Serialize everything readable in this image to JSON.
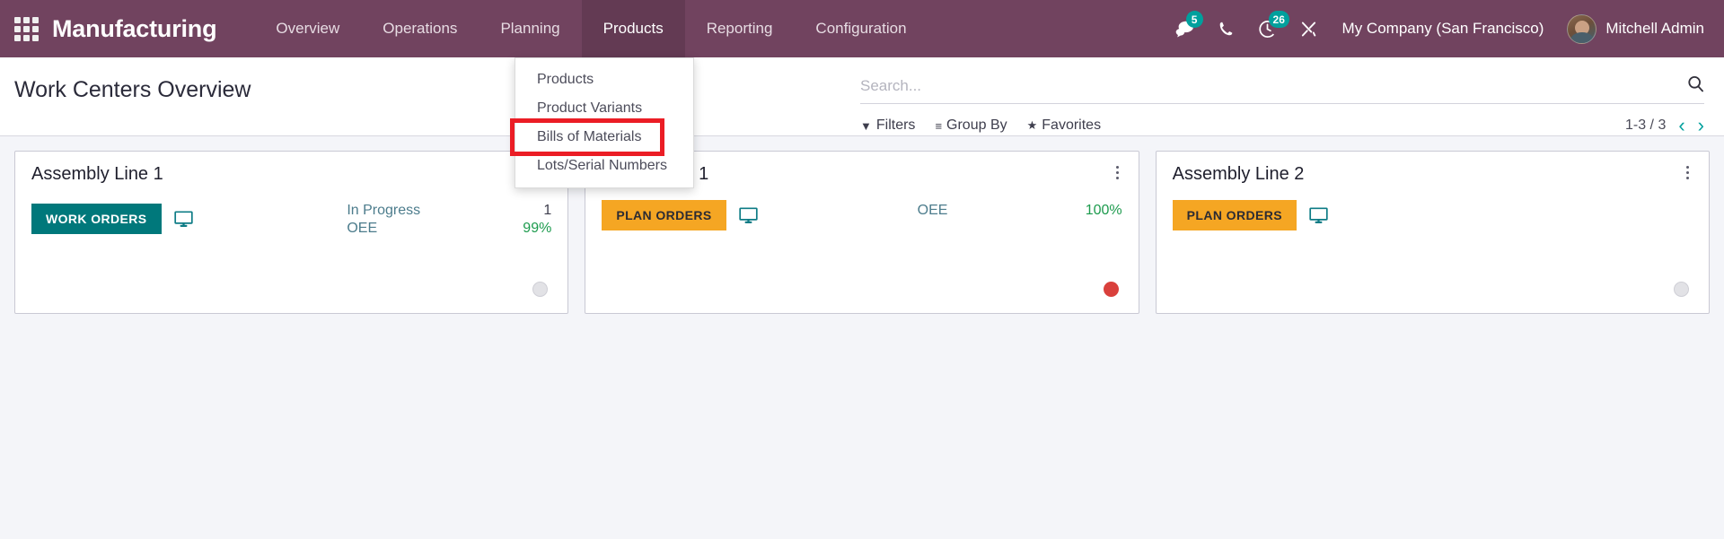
{
  "colors": {
    "navbar": "#71435F",
    "accent_teal": "#00A09D",
    "btn_work_orders": "#00787B",
    "btn_plan_orders": "#F5A623",
    "status_green": "#1D9B4E",
    "status_red": "#D9403C",
    "status_gray": "#E2E2E6",
    "highlight_box": "#EB1D25",
    "page_background": "#F4F5F9"
  },
  "navbar": {
    "apps_icon": "apps-grid-icon",
    "brand": "Manufacturing",
    "menu": [
      {
        "label": "Overview",
        "active": false
      },
      {
        "label": "Operations",
        "active": false
      },
      {
        "label": "Planning",
        "active": false
      },
      {
        "label": "Products",
        "active": true
      },
      {
        "label": "Reporting",
        "active": false
      },
      {
        "label": "Configuration",
        "active": false
      }
    ],
    "systray": [
      {
        "icon": "messages-icon",
        "badge": "5"
      },
      {
        "icon": "phone-icon",
        "badge": ""
      },
      {
        "icon": "activities-icon",
        "badge": "26"
      },
      {
        "icon": "tools-icon",
        "badge": ""
      }
    ],
    "company": "My Company (San Francisco)",
    "user": "Mitchell Admin"
  },
  "dropdown": {
    "open_for": "Products",
    "items": [
      {
        "label": "Products",
        "highlighted": false
      },
      {
        "label": "Product Variants",
        "highlighted": false
      },
      {
        "label": "Bills of Materials",
        "highlighted": true
      },
      {
        "label": "Lots/Serial Numbers",
        "highlighted": false
      }
    ]
  },
  "control_panel": {
    "title": "Work Centers Overview",
    "search": {
      "value": "",
      "placeholder": "Search..."
    },
    "tools": [
      {
        "label": "Filters",
        "icon": "filter-icon",
        "glyph": "▼"
      },
      {
        "label": "Group By",
        "icon": "group-by-icon",
        "glyph": "≡"
      },
      {
        "label": "Favorites",
        "icon": "star-icon",
        "glyph": "★"
      }
    ],
    "pager": {
      "range": "1-3 / 3",
      "prev": "‹",
      "next": "›"
    }
  },
  "kanban": {
    "cards": [
      {
        "title": "Assembly Line 1",
        "button": {
          "label": "WORK ORDERS",
          "style": "work"
        },
        "monitor_icon": "monitor-icon",
        "stats": [
          {
            "label": "In Progress",
            "value": "1",
            "green": false
          },
          {
            "label": "OEE",
            "value": "99%",
            "green": true
          }
        ],
        "status": "gray"
      },
      {
        "title": "Drill Station 1",
        "button": {
          "label": "PLAN ORDERS",
          "style": "plan"
        },
        "monitor_icon": "monitor-icon",
        "stats": [
          {
            "label": "OEE",
            "value": "100%",
            "green": true
          }
        ],
        "status": "red"
      },
      {
        "title": "Assembly Line 2",
        "button": {
          "label": "PLAN ORDERS",
          "style": "plan"
        },
        "monitor_icon": "monitor-icon",
        "stats": [],
        "status": "gray"
      }
    ]
  }
}
